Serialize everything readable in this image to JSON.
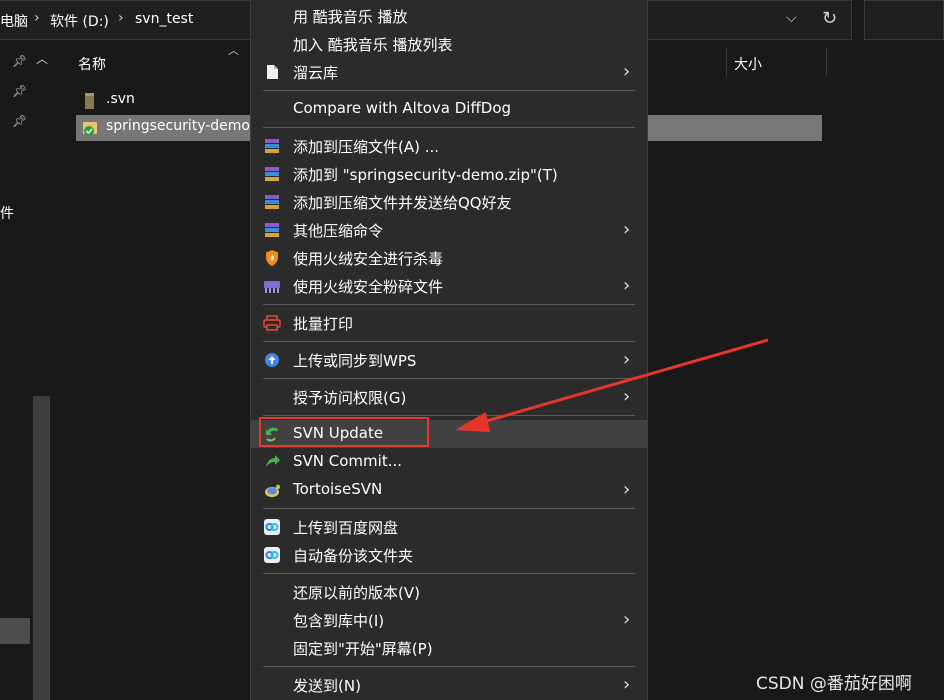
{
  "addressbar": {
    "crumbs": [
      "电脑",
      "软件 (D:)",
      "svn_test"
    ],
    "separator": "›",
    "history_icon": "chevron-down-icon",
    "refresh_icon": "refresh-icon"
  },
  "nav": {
    "partial_label": "件"
  },
  "filelist": {
    "columns": {
      "name": "名称",
      "size": "大小"
    },
    "items": [
      {
        "name": ".svn",
        "icon": "svn-folder-icon",
        "selected": false
      },
      {
        "name": "springsecurity-demo",
        "icon": "svn-versioned-folder-icon",
        "selected": true
      }
    ]
  },
  "menu": {
    "items": [
      {
        "label": "用 酷我音乐 播放",
        "icon": "",
        "arrow": false
      },
      {
        "label": "加入 酷我音乐 播放列表",
        "icon": "",
        "arrow": false
      },
      {
        "label": "溜云库",
        "icon": "document-icon",
        "arrow": true
      },
      {
        "label": "Compare with Altova DiffDog",
        "icon": "",
        "arrow": false
      },
      {
        "label": "添加到压缩文件(A) ...",
        "icon": "archive-icon",
        "arrow": false
      },
      {
        "label": "添加到 \"springsecurity-demo.zip\"(T)",
        "icon": "archive-icon",
        "arrow": false
      },
      {
        "label": "添加到压缩文件并发送给QQ好友",
        "icon": "archive-icon",
        "arrow": false
      },
      {
        "label": "其他压缩命令",
        "icon": "archive-icon",
        "arrow": true
      },
      {
        "label": "使用火绒安全进行杀毒",
        "icon": "huorong-shield-icon",
        "arrow": false
      },
      {
        "label": "使用火绒安全粉碎文件",
        "icon": "shredder-icon",
        "arrow": true
      },
      {
        "label": "批量打印",
        "icon": "printer-icon",
        "arrow": false
      },
      {
        "label": "上传或同步到WPS",
        "icon": "wps-cloud-upload-icon",
        "arrow": true
      },
      {
        "label": "授予访问权限(G)",
        "icon": "",
        "arrow": true
      },
      {
        "label": "SVN Update",
        "icon": "svn-update-icon",
        "arrow": false
      },
      {
        "label": "SVN Commit...",
        "icon": "svn-commit-icon",
        "arrow": false
      },
      {
        "label": "TortoiseSVN",
        "icon": "tortoisesvn-icon",
        "arrow": true
      },
      {
        "label": "上传到百度网盘",
        "icon": "baidu-netdisk-icon",
        "arrow": false
      },
      {
        "label": "自动备份该文件夹",
        "icon": "baidu-netdisk-icon",
        "arrow": false
      },
      {
        "label": "还原以前的版本(V)",
        "icon": "",
        "arrow": false
      },
      {
        "label": "包含到库中(I)",
        "icon": "",
        "arrow": true
      },
      {
        "label": "固定到\"开始\"屏幕(P)",
        "icon": "",
        "arrow": false
      },
      {
        "label": "发送到(N)",
        "icon": "",
        "arrow": true
      }
    ],
    "submenu_arrow": "›"
  },
  "colors": {
    "menu_bg": "#2b2b2b",
    "highlight_box": "#e33a2c",
    "annotation_arrow": "#e8352a",
    "selected_row": "#777777"
  },
  "watermark": "CSDN @番茄好困啊"
}
